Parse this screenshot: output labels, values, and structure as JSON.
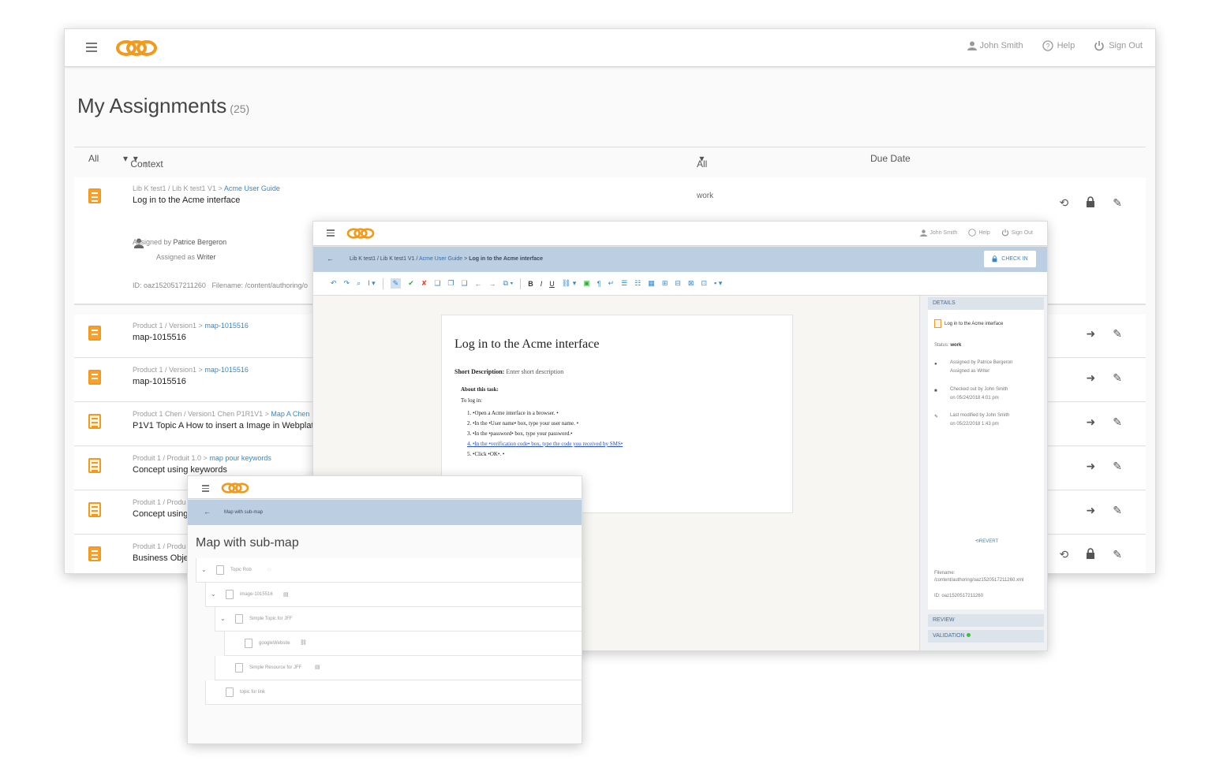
{
  "main": {
    "user": "John Smith",
    "help": "Help",
    "sign_out": "Sign Out",
    "title": "My Assignments",
    "count": "(25)",
    "filters": {
      "all": "All",
      "context": "Context",
      "status_all": "All",
      "due_date": "Due Date"
    },
    "rows": [
      {
        "path_prefix": "Lib K test1 / Lib K test1 V1 >",
        "path_link": "Acme User Guide",
        "name": "Log in to the Acme interface",
        "status": "work",
        "assigned_by_label": "Assigned by",
        "assigned_by": "Patrice Bergeron",
        "assigned_as_label": "Assigned as",
        "assigned_as": "Writer",
        "id_text": "ID: oaz1520517211260",
        "filename_text": "Filename: /content/authoring/o"
      },
      {
        "path_prefix": "Product 1 / Version1 >",
        "path_link": "map-1015516",
        "name": "map-1015516"
      },
      {
        "path_prefix": "Product 1 / Version1 >",
        "path_link": "map-1015516",
        "name": "map-1015516"
      },
      {
        "path_prefix": "Product 1 Chen / Version1 Chen P1R1V1 >",
        "path_link": "Map A Chen",
        "name": "P1V1 Topic A How to insert a Image in Webplat"
      },
      {
        "path_prefix": "Produit 1 / Produit 1.0 >",
        "path_link": "map pour keywords",
        "name": "Concept using keywords"
      },
      {
        "path_prefix": "Produit 1 / Produ",
        "path_link": "",
        "name": "Concept using"
      },
      {
        "path_prefix": "Produit 1 / Produ",
        "path_link": "",
        "name": "Business Obje"
      }
    ]
  },
  "editor": {
    "user": "John Smith",
    "help": "Help",
    "sign_out": "Sign Out",
    "breadcrumb_prefix": "Lib K test1 / Lib K test1 V1 /",
    "breadcrumb_link": "Acme User Guide",
    "breadcrumb_current": "Log in to the Acme interface",
    "check_in": "CHECK IN",
    "doc": {
      "title": "Log in to the Acme interface",
      "short_desc_label": "Short Description:",
      "short_desc": "Enter short description",
      "about": "About this task:",
      "to_log_in": "To log in:",
      "steps": [
        "1. •Open a Acme interface in a browser. •",
        "2. •In the •User name• box, type your user name. •",
        "3. •In the •password• box, type your password.•",
        "4. •In the •verification code• box, type the code you received by SMS•",
        "5. •Click •OK•. •"
      ]
    },
    "side": {
      "details": "DETAILS",
      "topic": "Log in to the Acme interface",
      "status_label": "Status:",
      "status": "work",
      "assigned_by": "Assigned by Patrice Bergeron",
      "assigned_as": "Assigned as Writer",
      "checked_out": "Checked out by John Smith",
      "checked_out_on": "on 05/24/2018 4:01 pm",
      "modified": "Last modified by John Smith",
      "modified_on": "on 05/22/2018 1:43 pm",
      "revert": "REVERT",
      "filename": "Filename: /content/authoring/oaz1520517211260.xml",
      "id": "ID: oaz1520517211260",
      "review": "REVIEW",
      "validation": "VALIDATION"
    }
  },
  "map": {
    "breadcrumb": "Map with sub-map",
    "title": "Map with sub-map",
    "items": [
      {
        "label": "Topic Rob"
      },
      {
        "label": "image-1015516"
      },
      {
        "label": "Simple Topic for JFF"
      },
      {
        "label": "googleWebsite"
      },
      {
        "label": "Simple Resource for JFF"
      },
      {
        "label": "topic for link"
      }
    ]
  },
  "colors": {
    "brand_orange": "#f29a1c",
    "crumb_blue": "#bccfe2",
    "link_blue": "#3a86c8",
    "validation_green": "#37c43a"
  }
}
